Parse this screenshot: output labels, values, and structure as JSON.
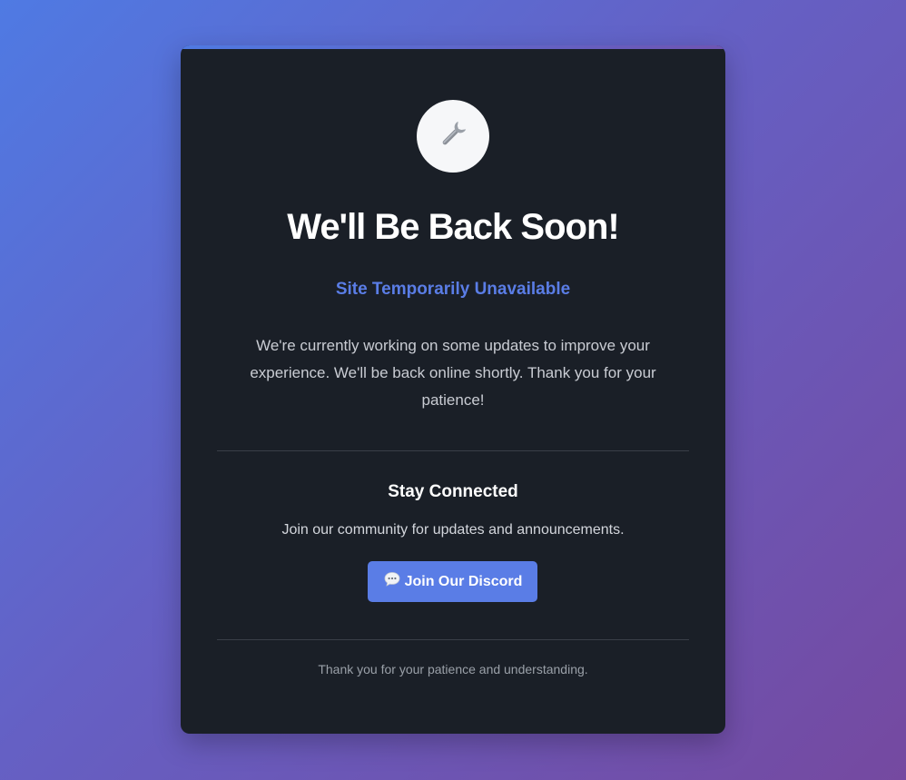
{
  "maintenance": {
    "icon": "wrench-icon",
    "title": "We'll Be Back Soon!",
    "subtitle": "Site Temporarily Unavailable",
    "description": "We're currently working on some updates to improve your experience. We'll be back online shortly. Thank you for your patience!"
  },
  "community": {
    "heading": "Stay Connected",
    "text": "Join our community for updates and announcements.",
    "button_icon": "speech-bubble-icon",
    "button_label": "Join Our Discord"
  },
  "footer": {
    "text": "Thank you for your patience and understanding."
  },
  "colors": {
    "accent": "#5a7de6",
    "card_background": "#1a1f27",
    "background_start": "#4f7ae3",
    "background_end": "#7549a0"
  }
}
